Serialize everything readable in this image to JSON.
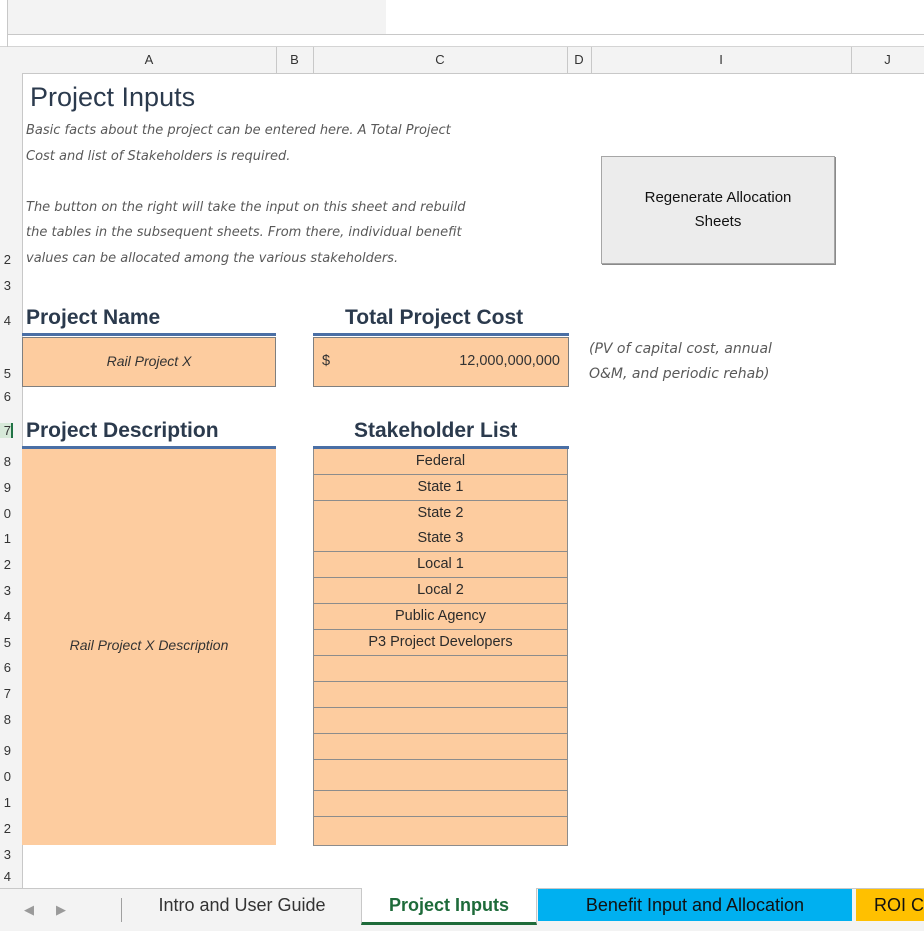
{
  "columns": [
    "A",
    "B",
    "C",
    "D",
    "I",
    "J"
  ],
  "row_numbers": [
    "2",
    "3",
    "4",
    "5",
    "6",
    "7",
    "8",
    "9",
    "0",
    "1",
    "2",
    "3",
    "4",
    "5",
    "6",
    "7",
    "8",
    "9",
    "0",
    "1",
    "2",
    "3",
    "4"
  ],
  "sheet": {
    "title": "Project Inputs",
    "intro_lines": [
      "Basic facts about the project can be entered here. A Total Project",
      "Cost and list of Stakeholders is required.",
      "The button on the right will take the input on this sheet and rebuild",
      "the tables in the subsequent sheets. From there, individual benefit",
      "values can be allocated among the various stakeholders."
    ],
    "regenerate_button": {
      "line1": "Regenerate Allocation",
      "line2": "Sheets"
    },
    "project_name": {
      "label": "Project Name",
      "value": "Rail Project X"
    },
    "total_cost": {
      "label": "Total Project Cost",
      "currency": "$",
      "value": "12,000,000,000",
      "note_line1": "(PV of capital cost, annual",
      "note_line2": "O&M, and periodic rehab)"
    },
    "project_description": {
      "label": "Project Description",
      "value": "Rail Project X Description"
    },
    "stakeholder_list": {
      "label": "Stakeholder List",
      "items": [
        "Federal",
        "State 1",
        "State 2",
        "State 3",
        "Local 1",
        "Local 2",
        "Public Agency",
        "P3 Project Developers",
        "",
        "",
        "",
        "",
        "",
        "",
        ""
      ]
    }
  },
  "tabs": {
    "items": [
      {
        "label": "Intro and User Guide"
      },
      {
        "label": "Project Inputs"
      },
      {
        "label": "Benefit Input and Allocation"
      },
      {
        "label": "ROI C"
      }
    ],
    "colors": {
      "active": "#ffffff",
      "benefit": "#00b0f0",
      "roi": "#ffc000",
      "active_text": "#1e6b3a"
    }
  }
}
